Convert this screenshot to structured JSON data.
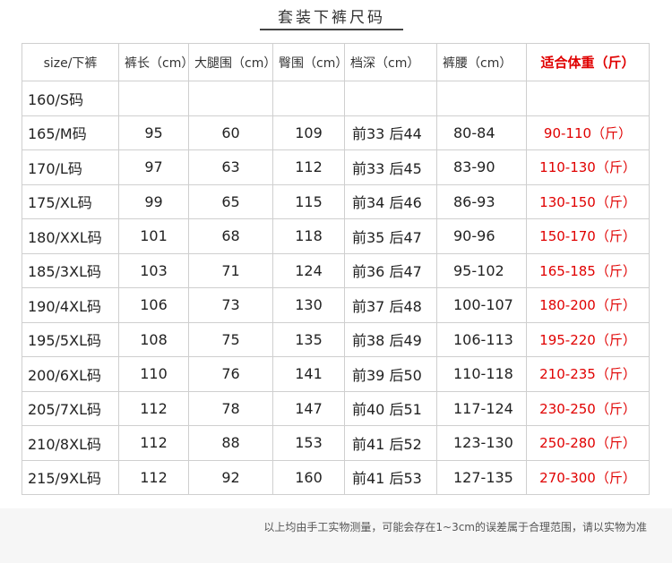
{
  "title": "套装下裤尺码",
  "table": {
    "headers": [
      "size/下裤",
      "裤长（cm）",
      "大腿围（cm）",
      "臀围（cm）",
      "档深（cm）",
      "裤腰（cm）",
      "适合体重（斤）"
    ],
    "rows": [
      [
        "160/S码",
        "",
        "",
        "",
        "",
        "",
        ""
      ],
      [
        "165/M码",
        "95",
        "60",
        "109",
        "前33 后44",
        "80-84",
        "90-110（斤）"
      ],
      [
        "170/L码",
        "97",
        "63",
        "112",
        "前33 后45",
        "83-90",
        "110-130（斤）"
      ],
      [
        "175/XL码",
        "99",
        "65",
        "115",
        "前34 后46",
        "86-93",
        "130-150（斤）"
      ],
      [
        "180/XXL码",
        "101",
        "68",
        "118",
        "前35 后47",
        "90-96",
        "150-170（斤）"
      ],
      [
        "185/3XL码",
        "103",
        "71",
        "124",
        "前36 后47",
        "95-102",
        "165-185（斤）"
      ],
      [
        "190/4XL码",
        "106",
        "73",
        "130",
        "前37 后48",
        "100-107",
        "180-200（斤）"
      ],
      [
        "195/5XL码",
        "108",
        "75",
        "135",
        "前38 后49",
        "106-113",
        "195-220（斤）"
      ],
      [
        "200/6XL码",
        "110",
        "76",
        "141",
        "前39 后50",
        "110-118",
        "210-235（斤）"
      ],
      [
        "205/7XL码",
        "112",
        "78",
        "147",
        "前40 后51",
        "117-124",
        "230-250（斤）"
      ],
      [
        "210/8XL码",
        "112",
        "88",
        "153",
        "前41 后52",
        "123-130",
        "250-280（斤）"
      ],
      [
        "215/9XL码",
        "112",
        "92",
        "160",
        "前41 后53",
        "127-135",
        "270-300（斤）"
      ]
    ]
  },
  "footnote": "以上均由手工实物测量，可能会存在1~3cm的误差属于合理范围，请以实物为准",
  "colors": {
    "weight_accent": "#e00000",
    "border": "#cfcfcf",
    "footer_bg": "#f6f6f6"
  }
}
